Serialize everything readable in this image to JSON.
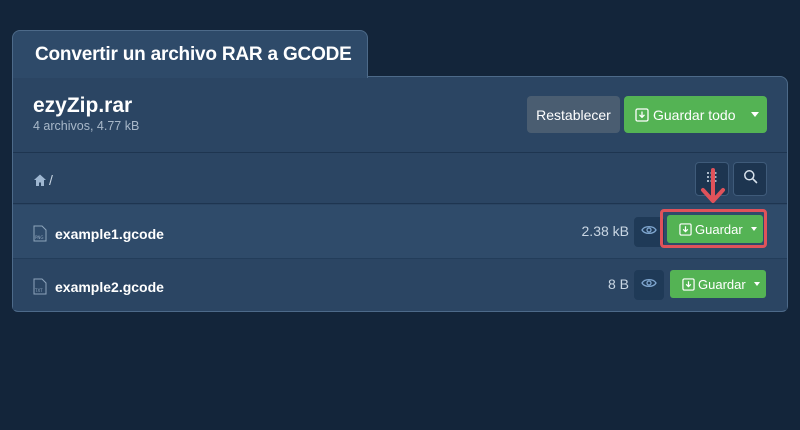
{
  "page": {
    "title": "Convertir un archivo RAR a GCODE"
  },
  "archive": {
    "name": "ezyZip.rar",
    "meta": "4 archivos, 4.77 kB",
    "reset_label": "Restablecer",
    "save_all_label": "Guardar todo"
  },
  "path": {
    "text": "/"
  },
  "files": [
    {
      "name": "example1.gcode",
      "size": "2.38 kB",
      "save_label": "Guardar",
      "icon_type": "PNG"
    },
    {
      "name": "example2.gcode",
      "size": "8 B",
      "save_label": "Guardar",
      "icon_type": "TXT"
    }
  ],
  "colors": {
    "background": "#13253a",
    "panel": "#2b4563",
    "accent_green": "#54b354",
    "highlight_red": "#e0525a"
  }
}
